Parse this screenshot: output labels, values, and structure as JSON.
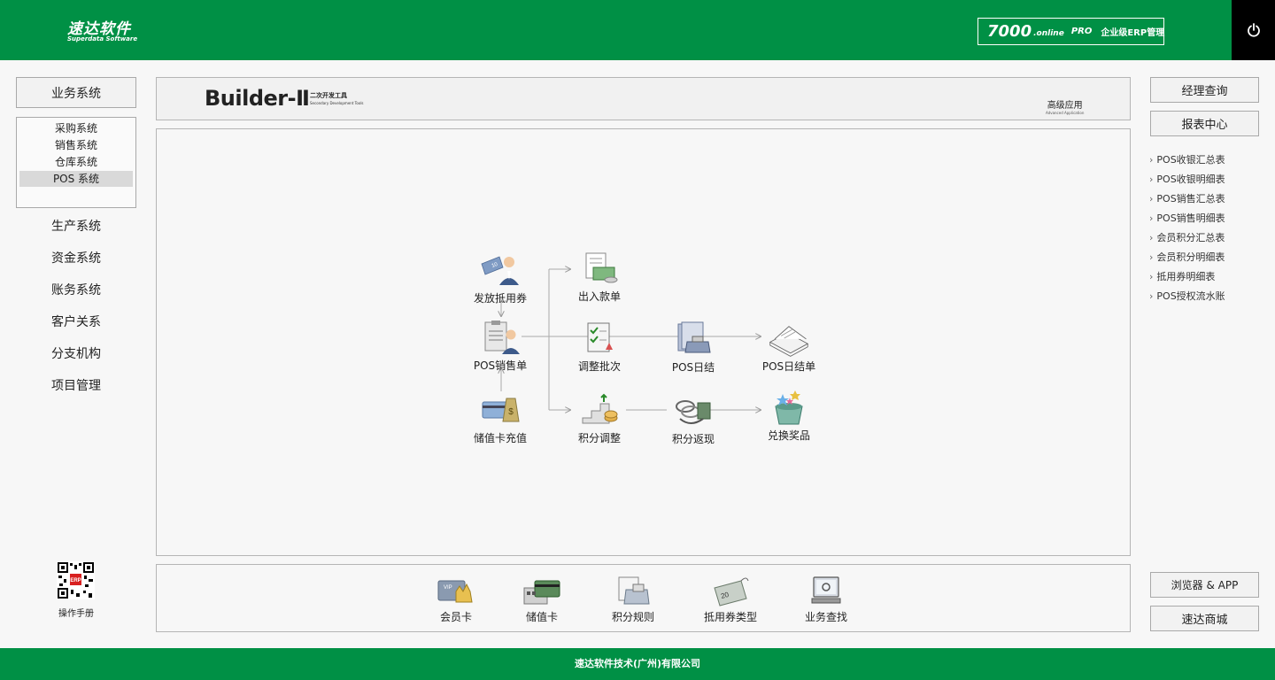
{
  "header": {
    "logo_zh": "速达软件",
    "logo_en": "Superdata Software",
    "product_num": "7000",
    "product_online": ".online",
    "product_pro": "PRO",
    "product_desc": "企业级ERP管理",
    "power_icon": "power-icon"
  },
  "left": {
    "business_btn": "业务系统",
    "sub_items": [
      "采购系统",
      "销售系统",
      "仓库系统",
      "POS 系统"
    ],
    "selected_sub": "POS 系统",
    "nav": [
      "生产系统",
      "资金系统",
      "账务系统",
      "客户关系",
      "分支机构",
      "项目管理"
    ],
    "manual_label": "操作手册"
  },
  "topbar": {
    "title": "Builder-Ⅱ",
    "subtitle_zh": "二次开发工具",
    "subtitle_en": "Secondary Development Tools",
    "advanced_zh": "高级应用",
    "advanced_en": "Advanced Application"
  },
  "flow": {
    "issue_voucher": "发放抵用券",
    "pos_sale": "POS销售单",
    "card_recharge": "储值卡充值",
    "cash_in_out": "出入款单",
    "adjust_batch": "调整批次",
    "points_adjust": "积分调整",
    "pos_daily": "POS日结",
    "points_cashback": "积分返现",
    "pos_daily_statement": "POS日结单",
    "redeem_prize": "兑换奖品"
  },
  "bottom": {
    "items": [
      "会员卡",
      "储值卡",
      "积分规则",
      "抵用券类型",
      "业务查找"
    ]
  },
  "right": {
    "manager_query": "经理查询",
    "report_center": "报表中心",
    "links": [
      "POS收银汇总表",
      "POS收银明细表",
      "POS销售汇总表",
      "POS销售明细表",
      "会员积分汇总表",
      "会员积分明细表",
      "抵用券明细表",
      "POS授权流水账"
    ],
    "browser_app": "浏览器 & APP",
    "mall": "速达商城"
  },
  "footer": {
    "company": "速达软件技术(广州)有限公司"
  },
  "colors": {
    "brand_green": "#009045",
    "header_black": "#000000",
    "panel_border": "#b5b5b5"
  }
}
